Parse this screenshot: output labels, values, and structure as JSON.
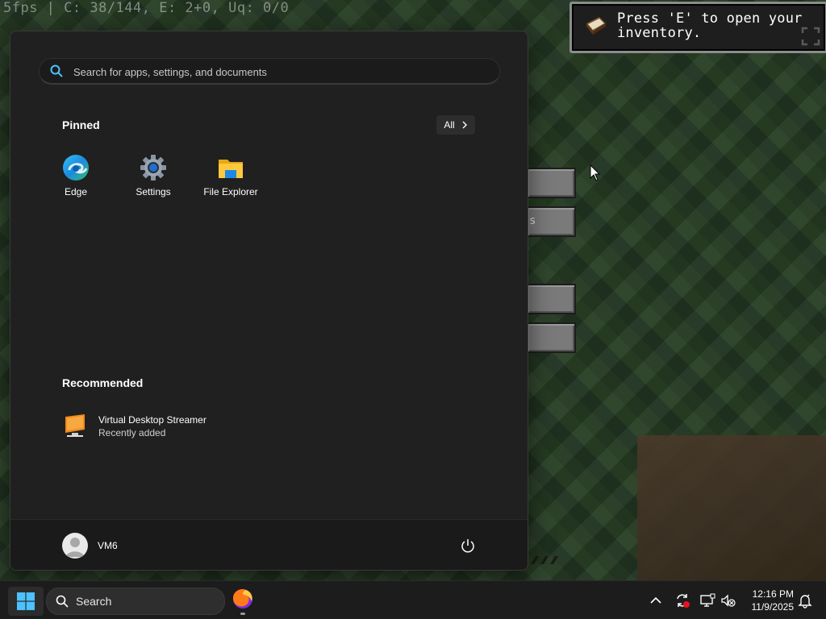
{
  "game": {
    "fps_text": "5fps | C: 38/144, E: 2+0, Uq: 0/0",
    "toast_text": "Press 'E' to open your\ninventory.",
    "menu_button_fragment": "s"
  },
  "start_menu": {
    "search_placeholder": "Search for apps, settings, and documents",
    "pinned_title": "Pinned",
    "all_button_label": "All",
    "pinned_apps": [
      {
        "label": "Edge",
        "icon": "edge-icon"
      },
      {
        "label": "Settings",
        "icon": "settings-gear-icon"
      },
      {
        "label": "File Explorer",
        "icon": "folder-icon"
      }
    ],
    "recommended_title": "Recommended",
    "recommended": [
      {
        "name": "Virtual Desktop Streamer",
        "subtitle": "Recently added",
        "icon": "monitor-icon"
      }
    ],
    "user_name": "VM6"
  },
  "taskbar": {
    "search_label": "Search",
    "time": "12:16 PM",
    "date": "11/9/2025"
  },
  "colors": {
    "accent": "#0078d4",
    "menu_bg": "#202020",
    "taskbar_bg": "#1c1c1c"
  }
}
